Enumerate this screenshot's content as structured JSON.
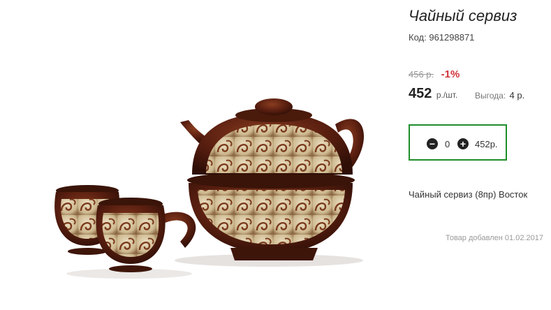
{
  "product": {
    "title": "Чайный сервиз",
    "code_label": "Код:",
    "code_value": "961298871",
    "old_price": "456 р.",
    "discount": "-1%",
    "price": "452",
    "price_unit": "р./шт.",
    "saving_label": "Выгода:",
    "saving_value": "4 р.",
    "description": "Чайный сервиз (8пр) Восток",
    "added_text": "Товар добавлен 01.02.2017"
  },
  "cart": {
    "minus_icon": "minus-circle-icon",
    "plus_icon": "plus-circle-icon",
    "quantity": "0",
    "sum": "452р."
  },
  "colors": {
    "accent_border": "#1f8e2a",
    "discount": "#d0343c",
    "ceramic_brown": "#5a1f10",
    "pattern_cream": "#d8c7a2"
  }
}
